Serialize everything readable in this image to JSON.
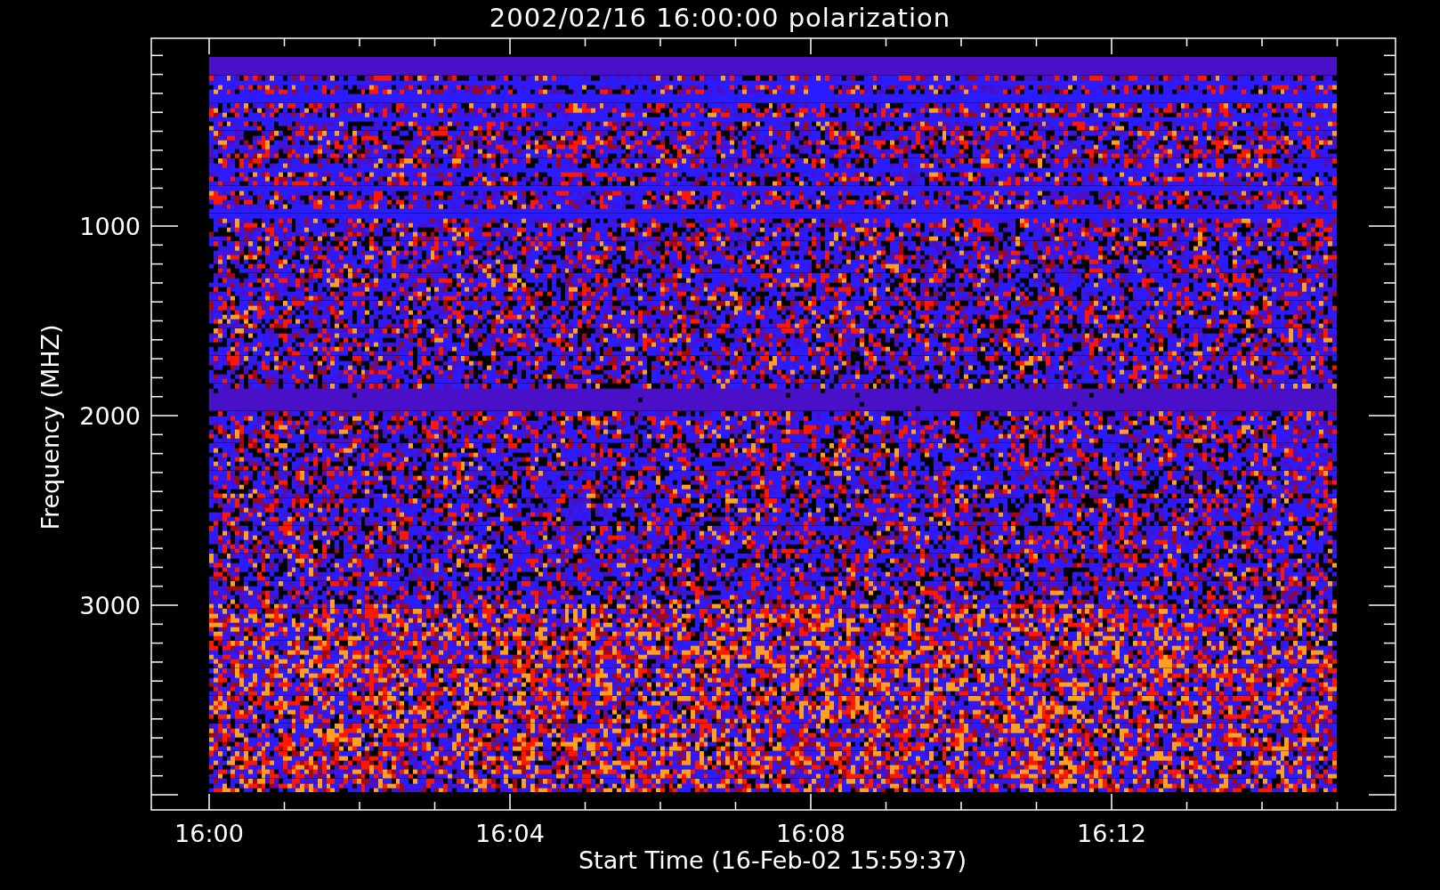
{
  "title": "2002/02/16 16:00:00 polarization",
  "plot": {
    "ylabel": "Frequency (MHZ)",
    "xlabel": "Start Time (16-Feb-02 15:59:37)",
    "yticks": [
      "1000",
      "2000",
      "3000"
    ],
    "xticks": [
      "16:00",
      "16:04",
      "16:08",
      "16:12"
    ]
  }
}
